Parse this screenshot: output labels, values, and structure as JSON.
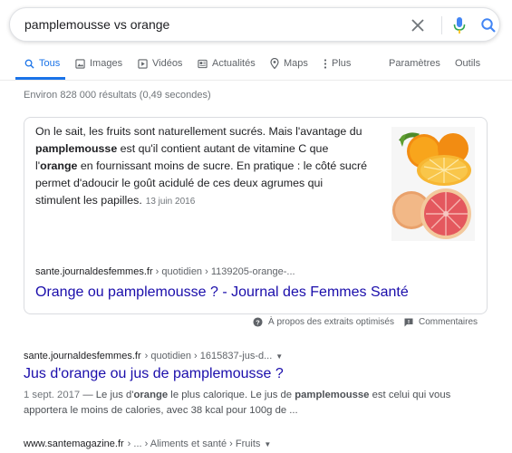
{
  "search": {
    "query": "pamplemousse vs orange"
  },
  "tabs": [
    {
      "label": "Tous",
      "icon": "search-icon",
      "active": true
    },
    {
      "label": "Images",
      "icon": "image-icon"
    },
    {
      "label": "Vidéos",
      "icon": "video-icon"
    },
    {
      "label": "Actualités",
      "icon": "news-icon"
    },
    {
      "label": "Maps",
      "icon": "map-pin-icon"
    },
    {
      "label": "Plus",
      "icon": "more-vert-icon"
    }
  ],
  "tools": {
    "settings_label": "Paramètres",
    "tools_label": "Outils"
  },
  "stats": "Environ 828 000 résultats (0,49 secondes)",
  "featured_snippet": {
    "text_parts": [
      {
        "t": "On le sait, les fruits sont naturellement sucrés. Mais l'avantage du ",
        "bold": false
      },
      {
        "t": "pamplemousse",
        "bold": true
      },
      {
        "t": " est qu'il contient autant de vitamine C que l'",
        "bold": false
      },
      {
        "t": "orange",
        "bold": true
      },
      {
        "t": " en fournissant moins de sucre. En pratique : le côté sucré permet d'adoucir le goût acidulé de ces deux agrumes qui stimulent les papilles.",
        "bold": false
      }
    ],
    "date": "13 juin 2016",
    "cite_domain": "sante.journaldesfemmes.fr",
    "cite_path": " › quotidien › 1139205-orange-...",
    "title": "Orange ou pamplemousse ? - Journal des Femmes Santé"
  },
  "feedback": {
    "about_label": "À propos des extraits optimisés",
    "comments_label": "Commentaires"
  },
  "results": [
    {
      "cite_domain": "sante.journaldesfemmes.fr",
      "cite_path": " › quotidien › 1615837-jus-d...",
      "title": "Jus d'orange ou jus de pamplemousse ?",
      "date": "1 sept. 2017",
      "snippet_parts": [
        {
          "t": " — Le jus d'",
          "bold": false
        },
        {
          "t": "orange",
          "bold": true
        },
        {
          "t": " le plus calorique. Le jus de ",
          "bold": false
        },
        {
          "t": "pamplemousse",
          "bold": true
        },
        {
          "t": " est celui qui vous apportera le moins de calories, avec 38 kcal pour 100g de ...",
          "bold": false
        }
      ]
    },
    {
      "cite_domain": "www.santemagazine.fr",
      "cite_path": " › ... › Aliments et santé › Fruits"
    }
  ],
  "colors": {
    "accent": "#1a73e8",
    "link": "#1a0dab",
    "orange": "#f39c12",
    "grapefruit": "#e8505b"
  }
}
